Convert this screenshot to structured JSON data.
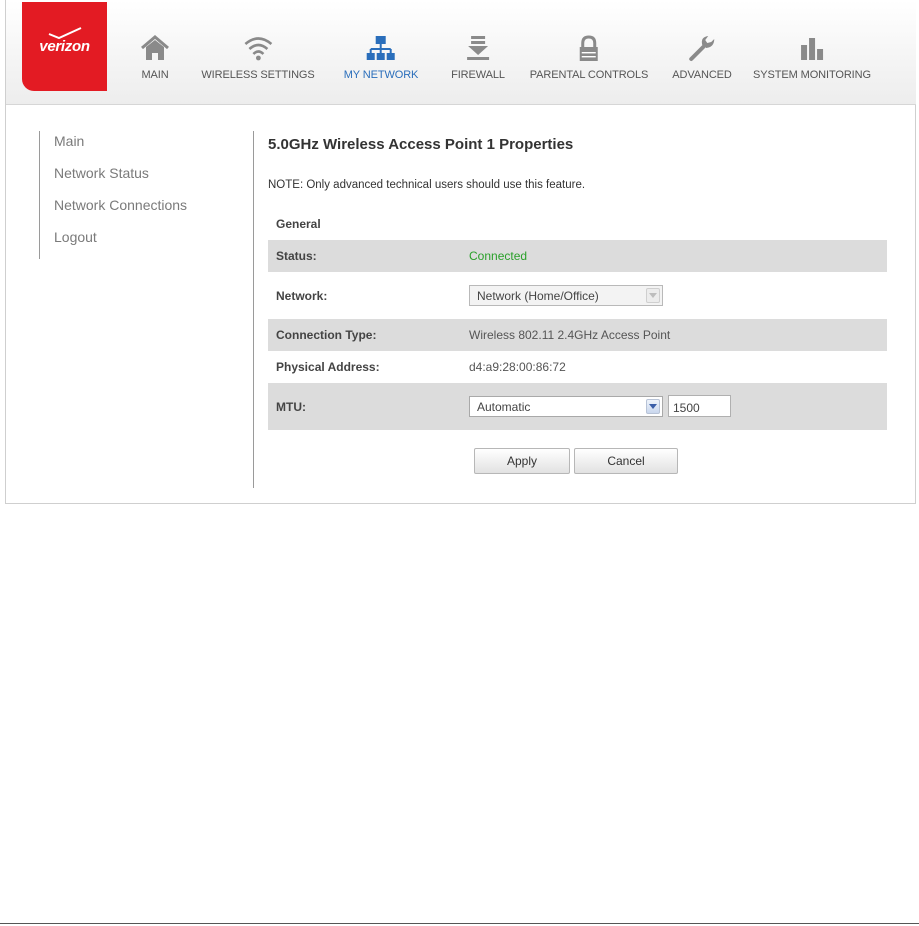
{
  "brand": {
    "logo_text": "verizon",
    "color": "#e31b23"
  },
  "nav": {
    "items": [
      {
        "label": "MAIN",
        "icon": "home-icon",
        "active": false
      },
      {
        "label": "WIRELESS SETTINGS",
        "icon": "wifi-icon",
        "active": false
      },
      {
        "label": "MY NETWORK",
        "icon": "network-icon",
        "active": true
      },
      {
        "label": "FIREWALL",
        "icon": "firewall-icon",
        "active": false
      },
      {
        "label": "PARENTAL CONTROLS",
        "icon": "lock-icon",
        "active": false
      },
      {
        "label": "ADVANCED",
        "icon": "wrench-icon",
        "active": false
      },
      {
        "label": "SYSTEM MONITORING",
        "icon": "bar-chart-icon",
        "active": false
      }
    ]
  },
  "sidebar": {
    "items": [
      {
        "label": "Main"
      },
      {
        "label": "Network Status"
      },
      {
        "label": "Network Connections"
      },
      {
        "label": "Logout"
      }
    ]
  },
  "main": {
    "title": "5.0GHz Wireless Access Point 1 Properties",
    "note": "NOTE: Only advanced technical users should use this feature.",
    "section": "General",
    "status": {
      "label": "Status:",
      "value": "Connected"
    },
    "network": {
      "label": "Network:",
      "value": "Network (Home/Office)"
    },
    "connection_type": {
      "label": "Connection Type:",
      "value": "Wireless 802.11 2.4GHz Access Point"
    },
    "physical_address": {
      "label": "Physical Address:",
      "value": "d4:a9:28:00:86:72"
    },
    "mtu": {
      "label": "MTU:",
      "mode": "Automatic",
      "value": "1500"
    },
    "apply_label": "Apply",
    "cancel_label": "Cancel"
  },
  "colors": {
    "active_nav": "#2a6ebb",
    "status_ok": "#2aa02a",
    "row_shade": "#dcdcdc"
  }
}
